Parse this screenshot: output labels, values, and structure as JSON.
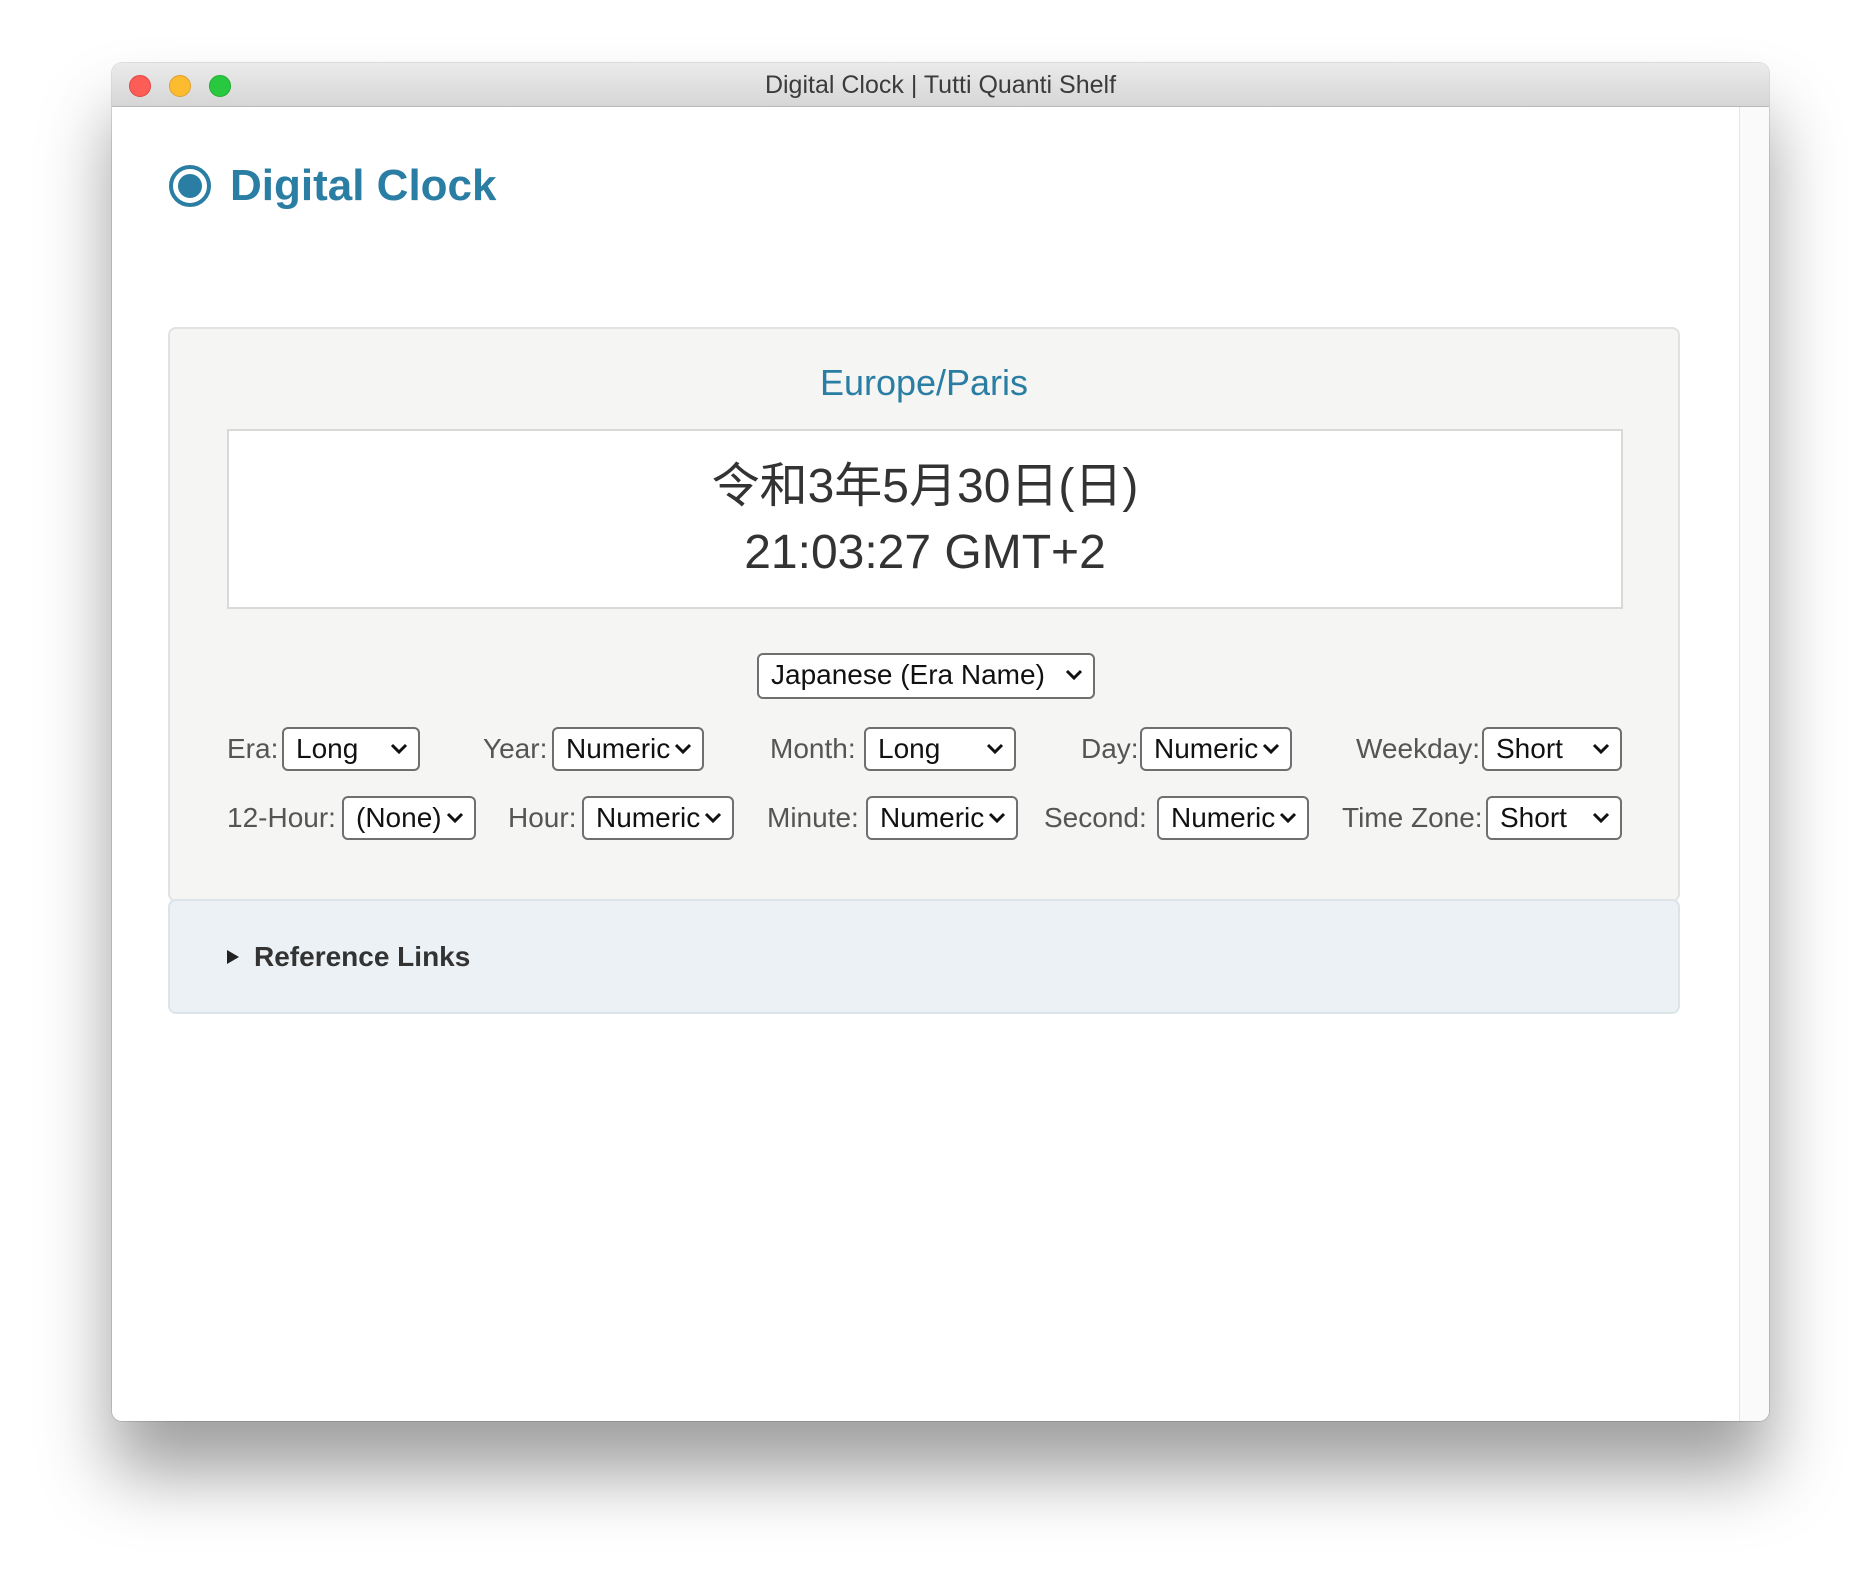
{
  "window": {
    "title": "Digital Clock | Tutti Quanti Shelf"
  },
  "app": {
    "title": "Digital Clock",
    "icon": "radio-dot-icon",
    "accent_color": "#2a7da3"
  },
  "clock": {
    "timezone": "Europe/Paris",
    "date_text": "令和3年5月30日(日)",
    "time_text": "21:03:27 GMT+2"
  },
  "calendar_select": {
    "value": "Japanese (Era Name)"
  },
  "options": {
    "era": {
      "label": "Era:",
      "value": "Long"
    },
    "year": {
      "label": "Year:",
      "value": "Numeric"
    },
    "month": {
      "label": "Month:",
      "value": "Long"
    },
    "day": {
      "label": "Day:",
      "value": "Numeric"
    },
    "weekday": {
      "label": "Weekday:",
      "value": "Short"
    },
    "hour12": {
      "label": "12-Hour:",
      "value": "(None)"
    },
    "hour": {
      "label": "Hour:",
      "value": "Numeric"
    },
    "minute": {
      "label": "Minute:",
      "value": "Numeric"
    },
    "second": {
      "label": "Second:",
      "value": "Numeric"
    },
    "timezone": {
      "label": "Time Zone:",
      "value": "Short"
    }
  },
  "reference": {
    "label": "Reference Links",
    "expanded": false
  }
}
